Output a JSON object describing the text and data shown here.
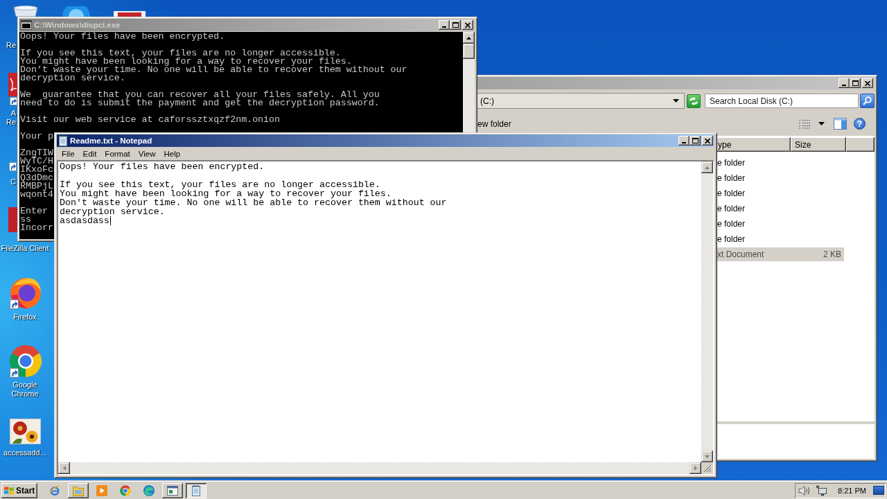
{
  "desktop": {
    "icons": [
      {
        "kind": "recycle-bin",
        "label_lines": [
          "Re"
        ]
      },
      {
        "kind": "round-app"
      },
      {
        "kind": "red-tile"
      },
      {
        "kind": "pdf-reader",
        "label_lines": [
          "A",
          "Re"
        ]
      },
      {
        "kind": "shortcut",
        "label_lines": [
          "C"
        ]
      },
      {
        "kind": "filezilla",
        "label_lines": [
          "FileZilla Client"
        ]
      },
      {
        "kind": "firefox",
        "label_lines": [
          "Firefox"
        ]
      },
      {
        "kind": "chrome",
        "label_lines": [
          "Google",
          "Chrome"
        ]
      },
      {
        "kind": "image",
        "label_lines": [
          "accessadd..."
        ]
      }
    ]
  },
  "console": {
    "title": "C:\\Windows\\dispci.exe",
    "active": false,
    "paragraphs": [
      [
        "Oops! Your files have been encrypted."
      ],
      [
        "If you see this text, your files are no longer accessible.",
        "You might have been looking for a way to recover your files.",
        "Don’t waste your time. No one will be able to recover them without our",
        "decryption service."
      ],
      [
        "We  guarantee that you can recover all your files safely. All you",
        "need to do is submit the payment and get the decryption password."
      ],
      [
        "Visit our web service at caforssztxqzf2nm.onion"
      ],
      [
        "Your p"
      ],
      [
        "ZngTIW",
        "WyTC/H",
        "IKxoFc",
        "Q3dDmc",
        "RMBPjL",
        "wqont4"
      ],
      [
        "Enter",
        "ss",
        "Incorr"
      ]
    ]
  },
  "explorer": {
    "active": false,
    "address": "(C:)",
    "search": {
      "placeholder": "Search Local Disk (C:)"
    },
    "toolbar": {
      "new_folder": "ew folder",
      "help": "?"
    },
    "columns": [
      "ype",
      "Size"
    ],
    "rows": [
      {
        "type": "e folder",
        "selected": false
      },
      {
        "type": "e folder",
        "selected": false
      },
      {
        "type": "e folder",
        "selected": false
      },
      {
        "type": "e folder",
        "selected": false
      },
      {
        "type": "e folder",
        "selected": false
      },
      {
        "type": "e folder",
        "selected": false
      },
      {
        "type": "xt Document",
        "size": "2 KB",
        "selected": true
      }
    ]
  },
  "notepad": {
    "title": "Readme.txt - Notepad",
    "active": true,
    "menu": [
      "File",
      "Edit",
      "Format",
      "View",
      "Help"
    ],
    "paragraphs": [
      [
        "Oops! Your files have been encrypted."
      ],
      [
        "If you see this text, your files are no longer accessible.",
        "You might have been looking for a way to recover your files.",
        "Don't waste your time. No one will be able to recover them without our",
        "decryption service."
      ]
    ],
    "typed_line": "asdasdass",
    "scrollbars": {
      "disabled": true
    }
  },
  "taskbar": {
    "start": "Start",
    "items": [
      {
        "kind": "ie",
        "running": false,
        "selected": false
      },
      {
        "kind": "folder",
        "running": true,
        "selected": false
      },
      {
        "kind": "media-player",
        "running": false,
        "selected": false
      },
      {
        "kind": "chrome",
        "running": false,
        "selected": false
      },
      {
        "kind": "edge",
        "running": false,
        "selected": false
      },
      {
        "kind": "console",
        "running": true,
        "selected": false
      },
      {
        "kind": "notepad",
        "running": true,
        "selected": true
      }
    ],
    "clock": "8:21 PM"
  }
}
